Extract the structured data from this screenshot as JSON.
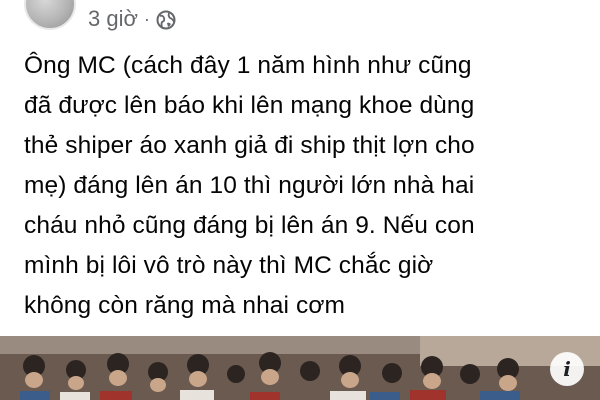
{
  "post": {
    "timestamp": "3 giờ",
    "separator": "·",
    "audience_icon": "globe-icon",
    "text": "Ông MC (cách đây 1 năm hình như cũng\nđã được lên báo khi lên mạng khoe dùng\nthẻ shiper áo xanh giả đi ship thịt lợn cho\nmẹ) đáng lên án 10 thì người lớn nhà hai\ncháu nhỏ cũng đáng bị lên án 9. Nếu con\nmình bị lôi vô trò này thì MC chắc giờ\nkhông còn răng mà nhai cơm",
    "photo": {
      "info_icon": "info-icon",
      "info_label": "i"
    }
  }
}
